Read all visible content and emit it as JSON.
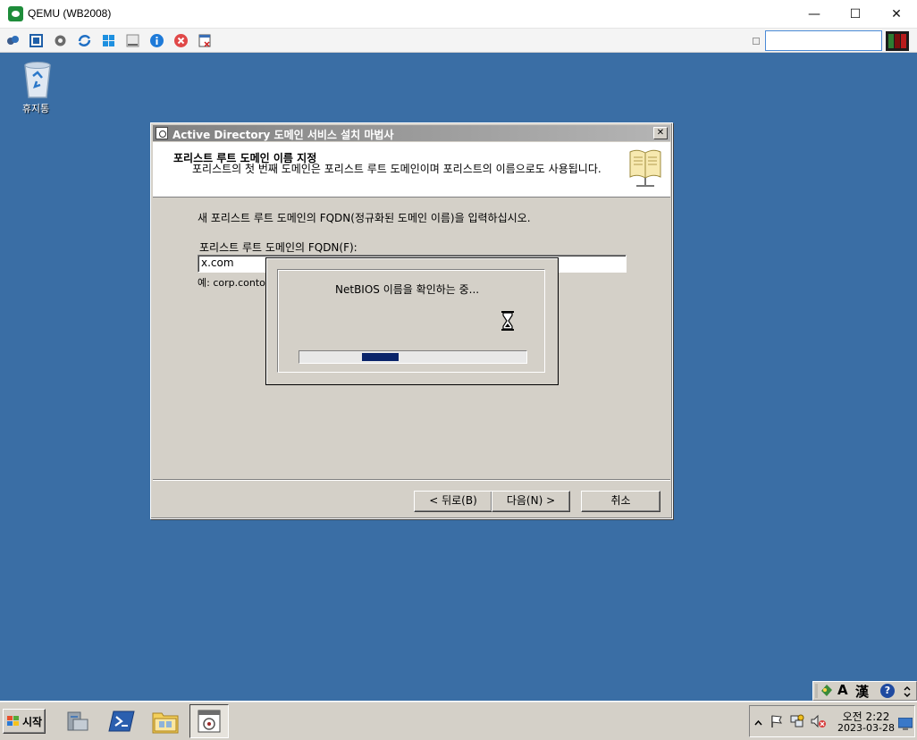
{
  "window": {
    "title": "QEMU (WB2008)"
  },
  "window_controls": {
    "minimize": "—",
    "maximize": "☐",
    "close": "✕"
  },
  "desktop": {
    "recycle_bin_label": "휴지통"
  },
  "wizard": {
    "title": "Active Directory 도메인 서비스 설치 마법사",
    "close_glyph": "✕",
    "header_title": "포리스트 루트 도메인 이름 지정",
    "header_subtitle": "포리스트의 첫 번째 도메인은 포리스트 루트 도메인이며 포리스트의 이름으로도 사용됩니다.",
    "prompt": "새 포리스트 루트 도메인의 FQDN(정규화된 도메인 이름)을 입력하십시오.",
    "fqdn_label": "포리스트 루트 도메인의 FQDN(F):",
    "fqdn_value": "x.com",
    "example_text": "예: corp.conto",
    "back_button": "< 뒤로(B)",
    "next_button": "다음(N) >",
    "cancel_button": "취소"
  },
  "progress_dialog": {
    "message": "NetBIOS 이름을 확인하는 중...",
    "progress_fraction": 0.18
  },
  "taskbar": {
    "start_label": "시작",
    "clock_time": "오전 2:22",
    "clock_date": "2023-03-28"
  },
  "ime": {
    "mode_a": "A",
    "mode_hanja": "漢",
    "help": "?"
  },
  "colors": {
    "desktop": "#3a6ea5",
    "progress_fill": "#0a246a",
    "window_face": "#d4d0c8"
  }
}
